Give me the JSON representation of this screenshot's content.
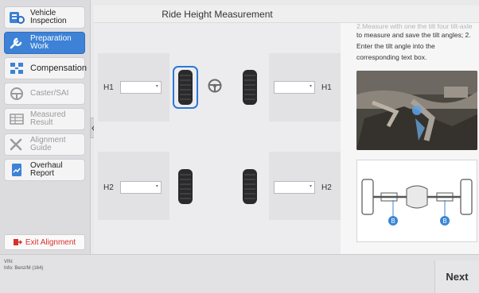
{
  "sidebar": {
    "items": [
      {
        "label": "Vehicle Inspection",
        "icon": "vehicle-inspection-icon",
        "state": "enabled"
      },
      {
        "label": "Preparation Work",
        "icon": "wrench-icon",
        "state": "active"
      },
      {
        "label": "Compensation",
        "icon": "compensation-icon",
        "state": "enabled"
      },
      {
        "label": "Caster/SAI",
        "icon": "steering-wheel-icon",
        "state": "disabled"
      },
      {
        "label": "Measured Result",
        "icon": "table-icon",
        "state": "disabled"
      },
      {
        "label": "Alignment Guide",
        "icon": "tools-icon",
        "state": "disabled"
      },
      {
        "label": "Overhaul Report",
        "icon": "report-icon",
        "state": "enabled"
      }
    ],
    "exit_label": "Exit Alignment"
  },
  "main": {
    "title": "Ride Height Measurement",
    "fields": [
      {
        "label": "H1",
        "value": ""
      },
      {
        "label": "H1",
        "value": ""
      },
      {
        "label": "H2",
        "value": ""
      },
      {
        "label": "H2",
        "value": ""
      }
    ]
  },
  "info": {
    "faded_line": "2.Measure with one the tilt four tilt-axle s",
    "text": "to measure and save the tilt angles; 2. Enter the tilt angle into the corresponding text box.",
    "marker_label": "B"
  },
  "footer": {
    "vin_label": "VIN:",
    "info_label": "Info: Benz/M (164)",
    "next_label": "Next"
  },
  "colors": {
    "accent": "#3d82d6",
    "exit": "#d8312b",
    "marker": "#3a86d6"
  }
}
